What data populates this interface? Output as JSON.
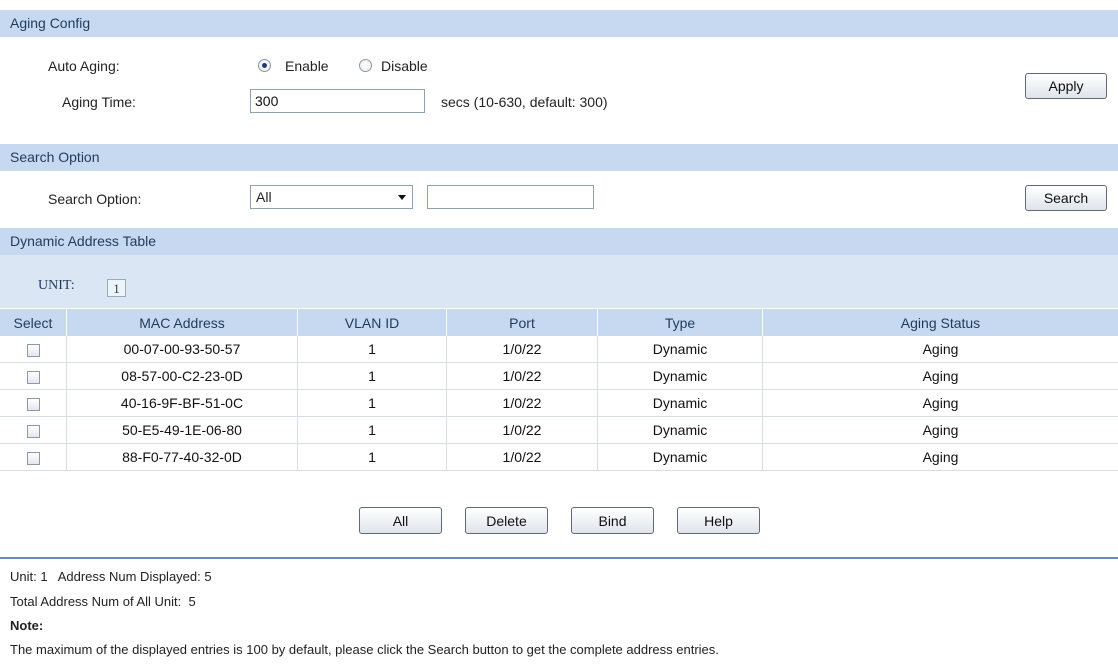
{
  "aging_config": {
    "header": "Aging Config",
    "auto_aging_label": "Auto Aging:",
    "enable_label": "Enable",
    "disable_label": "Disable",
    "auto_aging_selected": "Enable",
    "aging_time_label": "Aging Time:",
    "aging_time_value": "300",
    "aging_time_hint": "secs (10-630, default: 300)",
    "apply_label": "Apply"
  },
  "search_option": {
    "header": "Search Option",
    "label": "Search Option:",
    "selected": "All",
    "search_text": "",
    "search_label": "Search"
  },
  "table": {
    "header": "Dynamic Address Table",
    "unit_label": "UNIT:",
    "unit_value": "1",
    "columns": [
      "Select",
      "MAC Address",
      "VLAN ID",
      "Port",
      "Type",
      "Aging Status"
    ],
    "rows": [
      {
        "mac": "00-07-00-93-50-57",
        "vlan": "1",
        "port": "1/0/22",
        "type": "Dynamic",
        "status": "Aging",
        "checked": false
      },
      {
        "mac": "08-57-00-C2-23-0D",
        "vlan": "1",
        "port": "1/0/22",
        "type": "Dynamic",
        "status": "Aging",
        "checked": false
      },
      {
        "mac": "40-16-9F-BF-51-0C",
        "vlan": "1",
        "port": "1/0/22",
        "type": "Dynamic",
        "status": "Aging",
        "checked": false
      },
      {
        "mac": "50-E5-49-1E-06-80",
        "vlan": "1",
        "port": "1/0/22",
        "type": "Dynamic",
        "status": "Aging",
        "checked": false
      },
      {
        "mac": "88-F0-77-40-32-0D",
        "vlan": "1",
        "port": "1/0/22",
        "type": "Dynamic",
        "status": "Aging",
        "checked": false
      }
    ]
  },
  "actions": {
    "all_label": "All",
    "delete_label": "Delete",
    "bind_label": "Bind",
    "help_label": "Help"
  },
  "footer": {
    "unit_line": "Unit: 1   Address Num Displayed: 5",
    "total_line": "Total Address Num of All Unit:  5",
    "note_title": "Note:",
    "note_text": "The maximum of the displayed entries is 100 by default, please click the Search button to get the complete address entries."
  },
  "colors": {
    "header_bg": "#c6d9f1",
    "header_text": "#1f3b5c",
    "divider": "#6d8cb3"
  }
}
